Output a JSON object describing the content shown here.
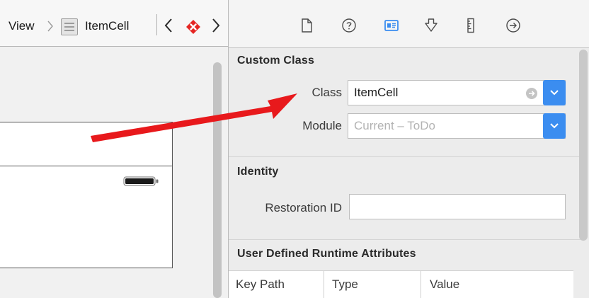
{
  "jump_bar": {
    "breadcrumb_view": "View",
    "breadcrumb_cell": "ItemCell",
    "icons": [
      "chevron-right-icon",
      "table-cell-icon",
      "chevron-left-icon",
      "issue-error-icon",
      "chevron-right-icon"
    ]
  },
  "inspector_toolbar": {
    "icons": [
      "file-inspector-icon",
      "quick-help-icon",
      "identity-inspector-icon",
      "attributes-inspector-icon",
      "size-inspector-icon",
      "connections-inspector-icon"
    ],
    "selected": "identity-inspector-icon",
    "accent_color": "#3b8df0"
  },
  "custom_class": {
    "title": "Custom Class",
    "class_label": "Class",
    "class_value": "ItemCell",
    "module_label": "Module",
    "module_placeholder": "Current – ToDo"
  },
  "identity": {
    "title": "Identity",
    "restoration_label": "Restoration ID",
    "restoration_value": ""
  },
  "runtime_attributes": {
    "title": "User Defined Runtime Attributes",
    "columns": [
      "Key Path",
      "Type",
      "Value"
    ]
  },
  "annotation": {
    "arrow_color": "#e8191c"
  }
}
